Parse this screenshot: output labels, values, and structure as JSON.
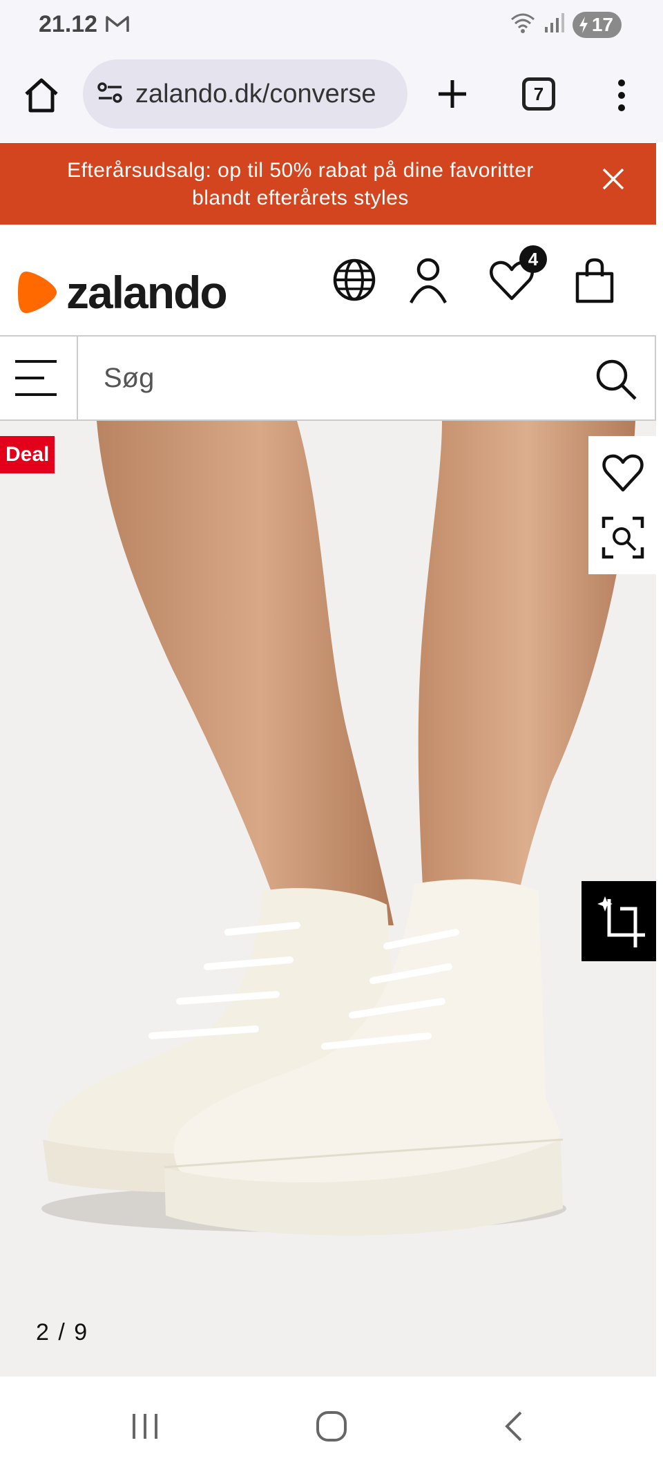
{
  "status_bar": {
    "time": "21.12",
    "battery": "17",
    "icons": [
      "mail-icon",
      "wifi-icon",
      "signal-icon",
      "battery-charging-icon"
    ]
  },
  "browser": {
    "url": "zalando.dk/converse",
    "tab_count": "7",
    "icons": [
      "home-icon",
      "site-settings-icon",
      "plus-icon",
      "more-vertical-icon"
    ]
  },
  "promo": {
    "text_line1": "Efterårsudsalg: op til 50% rabat på dine favoritter",
    "text_line2": "blandt efterårets styles",
    "bg_color": "#d3451f"
  },
  "header": {
    "logo_text": "zalando",
    "brand_color": "#ff6900",
    "wishlist_count": "4",
    "icons": [
      "globe-icon",
      "account-icon",
      "heart-icon",
      "bag-icon"
    ]
  },
  "search": {
    "placeholder": "Søg"
  },
  "product": {
    "badge": "Deal",
    "badge_color": "#e3001b",
    "pager": "2 / 9",
    "image_description_icons": [
      "heart-icon",
      "visual-search-icon",
      "ai-crop-icon"
    ]
  },
  "nav": {
    "icons": [
      "recent-apps-icon",
      "home-circle-icon",
      "back-icon"
    ]
  }
}
